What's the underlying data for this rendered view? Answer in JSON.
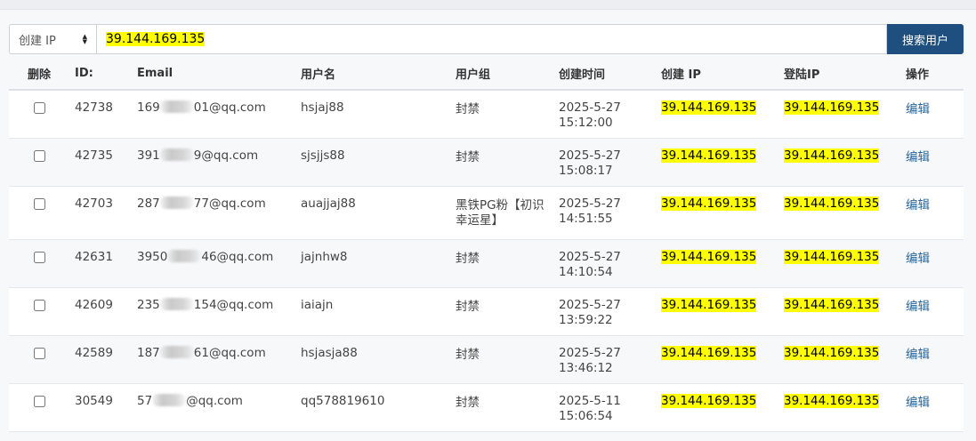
{
  "search": {
    "select_value": "创建 IP",
    "input_value": "39.144.169.135",
    "button_label": "搜索用户"
  },
  "table": {
    "headers": {
      "delete": "删除",
      "id": "ID:",
      "email": "Email",
      "username": "用户名",
      "group": "用户组",
      "created_time": "创建时间",
      "created_ip": "创建 IP",
      "login_ip": "登陆IP",
      "action": "操作"
    },
    "rows": [
      {
        "id": "42738",
        "email_prefix": "169",
        "email_suffix": "01@qq.com",
        "username": "hsjaj88",
        "group": "封禁",
        "date": "2025-5-27",
        "time": "15:12:00",
        "created_ip": "39.144.169.135",
        "login_ip": "39.144.169.135",
        "action": "编辑"
      },
      {
        "id": "42735",
        "email_prefix": "391",
        "email_suffix": "9@qq.com",
        "username": "sjsjjs88",
        "group": "封禁",
        "date": "2025-5-27",
        "time": "15:08:17",
        "created_ip": "39.144.169.135",
        "login_ip": "39.144.169.135",
        "action": "编辑"
      },
      {
        "id": "42703",
        "email_prefix": "287",
        "email_suffix": "77@qq.com",
        "username": "auajjaj88",
        "group": "黑铁PG粉【初识幸运星】",
        "date": "2025-5-27",
        "time": "14:51:55",
        "created_ip": "39.144.169.135",
        "login_ip": "39.144.169.135",
        "action": "编辑"
      },
      {
        "id": "42631",
        "email_prefix": "3950",
        "email_suffix": "46@qq.com",
        "username": "jajnhw8",
        "group": "封禁",
        "date": "2025-5-27",
        "time": "14:10:54",
        "created_ip": "39.144.169.135",
        "login_ip": "39.144.169.135",
        "action": "编辑"
      },
      {
        "id": "42609",
        "email_prefix": "235",
        "email_suffix": "154@qq.com",
        "username": "iaiajn",
        "group": "封禁",
        "date": "2025-5-27",
        "time": "13:59:22",
        "created_ip": "39.144.169.135",
        "login_ip": "39.144.169.135",
        "action": "编辑"
      },
      {
        "id": "42589",
        "email_prefix": "187",
        "email_suffix": "61@qq.com",
        "username": "hsjasja88",
        "group": "封禁",
        "date": "2025-5-27",
        "time": "13:46:12",
        "created_ip": "39.144.169.135",
        "login_ip": "39.144.169.135",
        "action": "编辑"
      },
      {
        "id": "30549",
        "email_prefix": "57",
        "email_suffix": "@qq.com",
        "username": "qq578819610",
        "group": "封禁",
        "date": "2025-5-11",
        "time": "15:06:54",
        "created_ip": "39.144.169.135",
        "login_ip": "39.144.169.135",
        "action": "编辑"
      }
    ]
  },
  "colors": {
    "highlight": "#ffff00",
    "button_bg": "#1f4f7f",
    "link": "#2a6496"
  }
}
